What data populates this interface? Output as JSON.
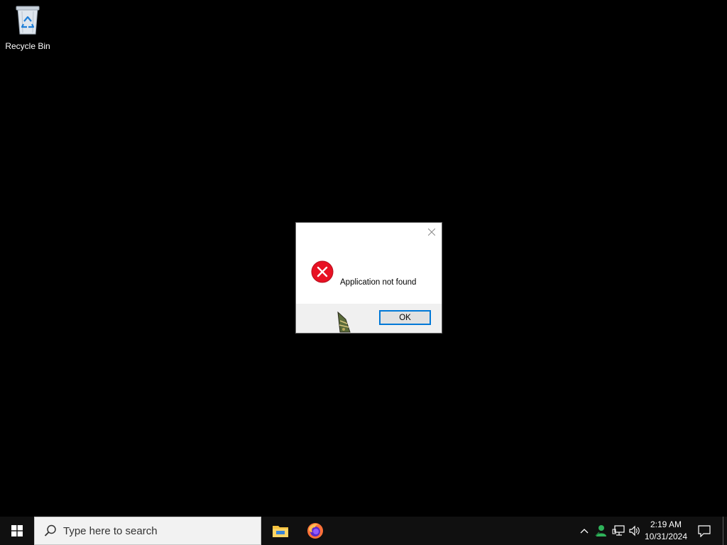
{
  "desktop": {
    "icons": [
      {
        "label": "Recycle Bin",
        "icon": "recycle-bin-icon"
      }
    ]
  },
  "dialog": {
    "message": "Application not found",
    "ok_label": "OK",
    "icon": "error-icon",
    "error_color": "#e81123"
  },
  "taskbar": {
    "search_placeholder": "Type here to search",
    "pinned_apps": [
      "file-explorer-icon",
      "firefox-icon"
    ],
    "tray_icons": [
      "chevron-up-icon",
      "network-user-icon",
      "network-icon",
      "volume-icon"
    ],
    "clock": {
      "time": "2:19 AM",
      "date": "10/31/2024"
    }
  }
}
